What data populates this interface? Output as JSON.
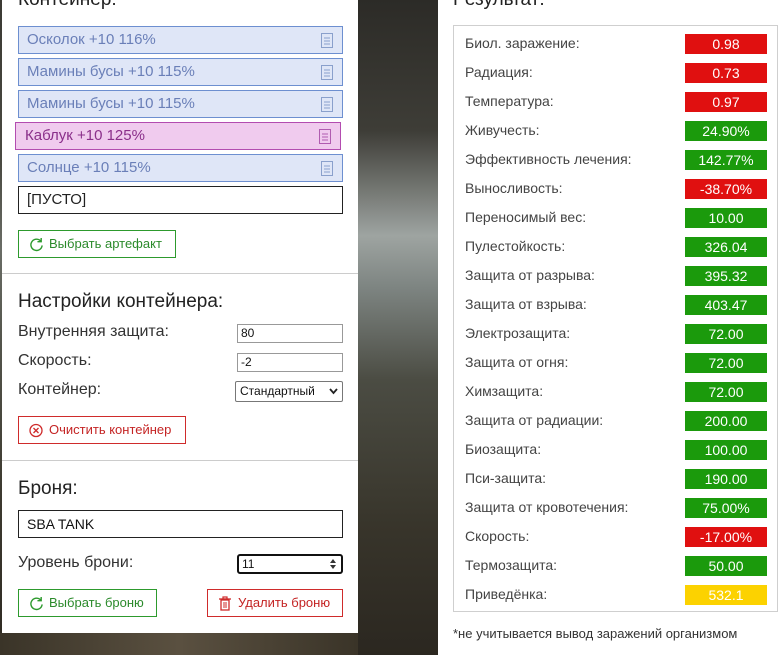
{
  "container": {
    "title": "Контейнер:",
    "slots": [
      {
        "label": "Осколок +10 116%",
        "style": "blue"
      },
      {
        "label": "Мамины бусы +10 115%",
        "style": "blue"
      },
      {
        "label": "Мамины бусы +10 115%",
        "style": "blue"
      },
      {
        "label": "Каблук +10 125%",
        "style": "pink"
      },
      {
        "label": "Солнце +10 115%",
        "style": "blue"
      },
      {
        "label": "[ПУСТО]",
        "style": "empty"
      }
    ],
    "select_artifact_label": "Выбрать артефакт"
  },
  "settings": {
    "title": "Настройки контейнера:",
    "inner_protection_label": "Внутренняя защита:",
    "inner_protection_value": "80",
    "speed_label": "Скорость:",
    "speed_value": "-2",
    "container_label": "Контейнер:",
    "container_value": "Стандартный",
    "clear_label": "Очистить контейнер"
  },
  "armor": {
    "title": "Броня:",
    "name": "SBA TANK",
    "level_label": "Уровень брони:",
    "level_value": "11",
    "select_label": "Выбрать броню",
    "delete_label": "Удалить броню"
  },
  "result": {
    "title": "Результат:",
    "rows": [
      {
        "label": "Биол. заражение:",
        "value": "0.98",
        "color": "red"
      },
      {
        "label": "Радиация:",
        "value": "0.73",
        "color": "red"
      },
      {
        "label": "Температура:",
        "value": "0.97",
        "color": "red"
      },
      {
        "label": "Живучесть:",
        "value": "24.90%",
        "color": "green"
      },
      {
        "label": "Эффективность лечения:",
        "value": "142.77%",
        "color": "green"
      },
      {
        "label": "Выносливость:",
        "value": "-38.70%",
        "color": "red"
      },
      {
        "label": "Переносимый вес:",
        "value": "10.00",
        "color": "green"
      },
      {
        "label": "Пулестойкость:",
        "value": "326.04",
        "color": "green"
      },
      {
        "label": "Защита от разрыва:",
        "value": "395.32",
        "color": "green"
      },
      {
        "label": "Защита от взрыва:",
        "value": "403.47",
        "color": "green"
      },
      {
        "label": "Электрозащита:",
        "value": "72.00",
        "color": "green"
      },
      {
        "label": "Защита от огня:",
        "value": "72.00",
        "color": "green"
      },
      {
        "label": "Химзащита:",
        "value": "72.00",
        "color": "green"
      },
      {
        "label": "Защита от радиации:",
        "value": "200.00",
        "color": "green"
      },
      {
        "label": "Биозащита:",
        "value": "100.00",
        "color": "green"
      },
      {
        "label": "Пси-защита:",
        "value": "190.00",
        "color": "green"
      },
      {
        "label": "Защита от кровотечения:",
        "value": "75.00%",
        "color": "green"
      },
      {
        "label": "Скорость:",
        "value": "-17.00%",
        "color": "red"
      },
      {
        "label": "Термозащита:",
        "value": "50.00",
        "color": "green"
      },
      {
        "label": "Приведёнка:",
        "value": "532.1",
        "color": "yellow"
      }
    ],
    "footnote": "*не учитывается вывод заражений организмом"
  },
  "colors": {
    "red": "#e01010",
    "green": "#1b9a0c",
    "yellow": "#fcd200",
    "slot_blue_bg": "#dfe6f7",
    "slot_blue_border": "#6d8fd0",
    "slot_pink_bg": "#f0cbee",
    "slot_pink_border": "#b34cb0"
  },
  "icons": {
    "slot": "document-icon",
    "select_artifact": "refresh-icon",
    "clear": "close-circle-icon",
    "select_armor": "refresh-icon",
    "delete_armor": "trash-icon"
  }
}
